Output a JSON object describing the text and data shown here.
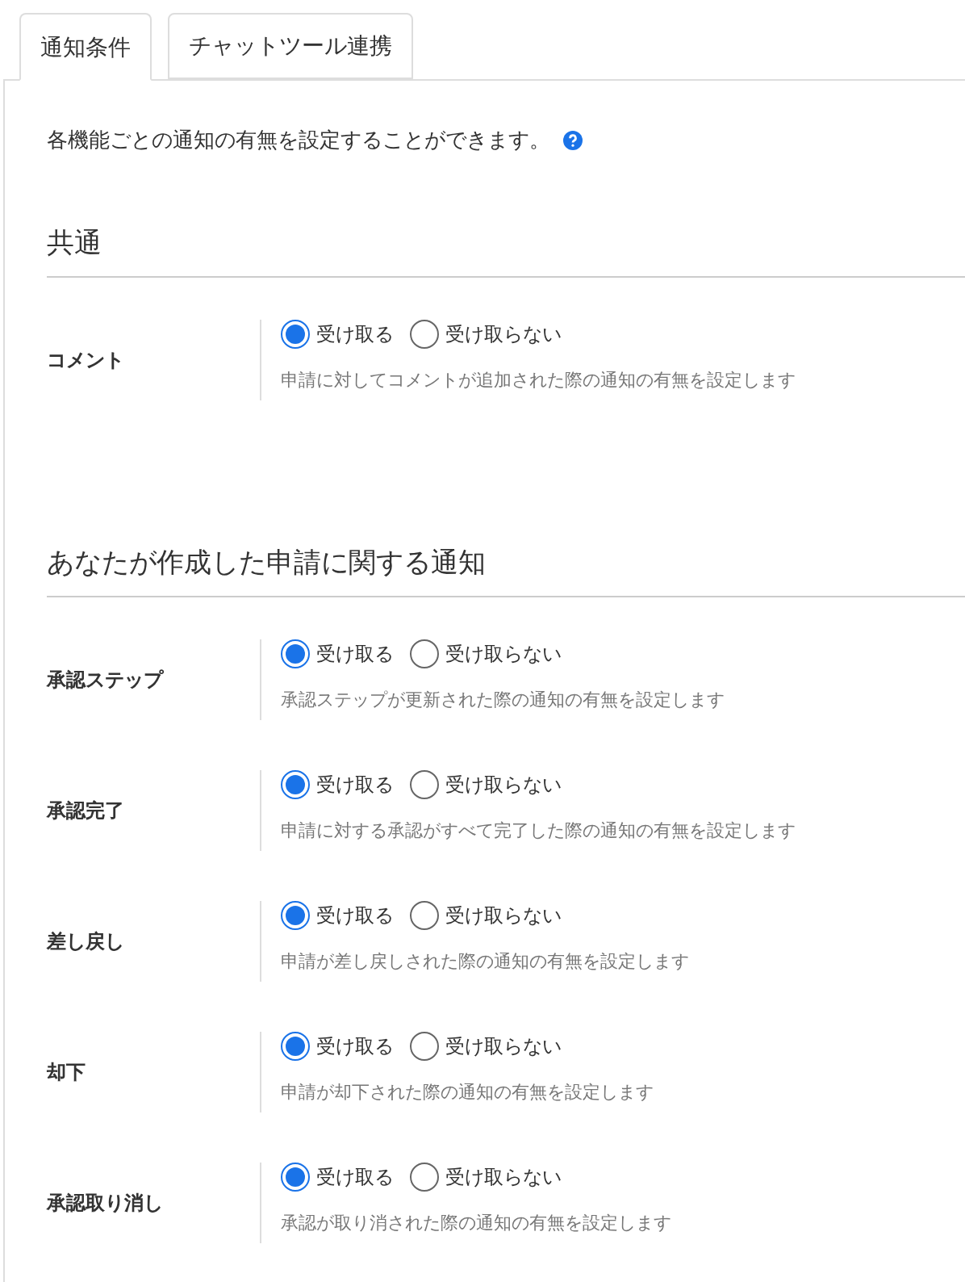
{
  "tabs": [
    {
      "label": "通知条件",
      "selected": true
    },
    {
      "label": "チャットツール連携",
      "selected": false
    }
  ],
  "intro": "各機能ごとの通知の有無を設定することができます。",
  "sections": [
    {
      "title": "共通",
      "rows": [
        {
          "label": "コメント",
          "options": [
            {
              "label": "受け取る",
              "selected": true
            },
            {
              "label": "受け取らない",
              "selected": false
            }
          ],
          "description": "申請に対してコメントが追加された際の通知の有無を設定します"
        }
      ]
    },
    {
      "title": "あなたが作成した申請に関する通知",
      "rows": [
        {
          "label": "承認ステップ",
          "options": [
            {
              "label": "受け取る",
              "selected": true
            },
            {
              "label": "受け取らない",
              "selected": false
            }
          ],
          "description": "承認ステップが更新された際の通知の有無を設定します"
        },
        {
          "label": "承認完了",
          "options": [
            {
              "label": "受け取る",
              "selected": true
            },
            {
              "label": "受け取らない",
              "selected": false
            }
          ],
          "description": "申請に対する承認がすべて完了した際の通知の有無を設定します"
        },
        {
          "label": "差し戻し",
          "options": [
            {
              "label": "受け取る",
              "selected": true
            },
            {
              "label": "受け取らない",
              "selected": false
            }
          ],
          "description": "申請が差し戻しされた際の通知の有無を設定します"
        },
        {
          "label": "却下",
          "options": [
            {
              "label": "受け取る",
              "selected": true
            },
            {
              "label": "受け取らない",
              "selected": false
            }
          ],
          "description": "申請が却下された際の通知の有無を設定します"
        },
        {
          "label": "承認取り消し",
          "options": [
            {
              "label": "受け取る",
              "selected": true
            },
            {
              "label": "受け取らない",
              "selected": false
            }
          ],
          "description": "承認が取り消された際の通知の有無を設定します"
        }
      ]
    }
  ]
}
